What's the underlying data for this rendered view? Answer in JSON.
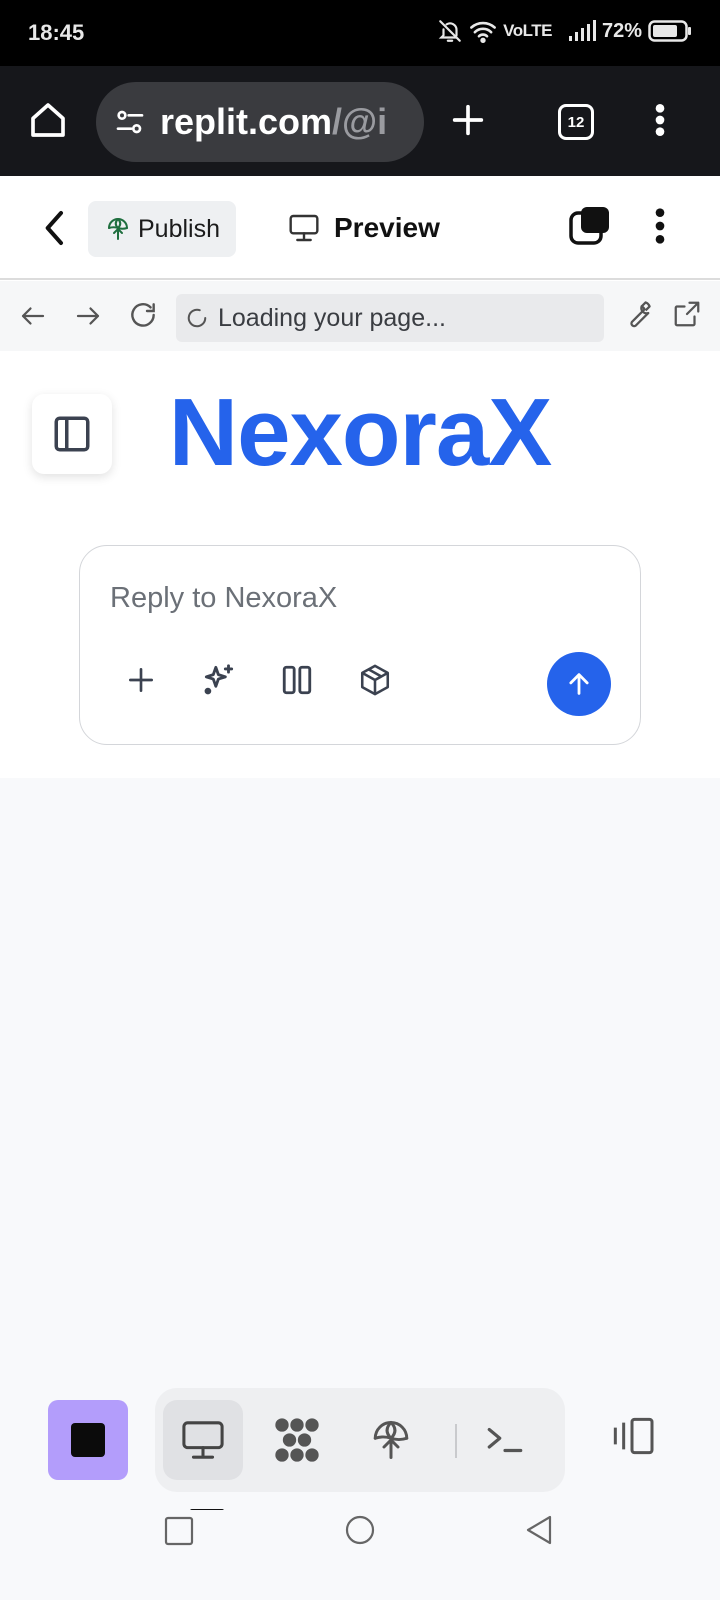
{
  "status_bar": {
    "time": "18:45",
    "network_label": "VoLTE",
    "battery": "72%"
  },
  "browser": {
    "url_host": "replit.com",
    "url_path": "/@i",
    "tab_count": "12"
  },
  "replit_header": {
    "publish_label": "Publish",
    "preview_label": "Preview"
  },
  "webview": {
    "loading_text": "Loading your page..."
  },
  "app": {
    "brand_title": "NexoraX",
    "composer_placeholder": "Reply to NexoraX"
  },
  "colors": {
    "brand_blue": "#2563eb",
    "stop_purple": "#b39dfb",
    "publish_green": "#1f6f3f"
  },
  "icons": {
    "composer_tools": [
      "plus-icon",
      "sparkles-icon",
      "columns-icon",
      "cube-icon"
    ],
    "bottom_nav": [
      "monitor-icon",
      "workspace-grid-icon",
      "publish-icon",
      "terminal-icon"
    ]
  }
}
